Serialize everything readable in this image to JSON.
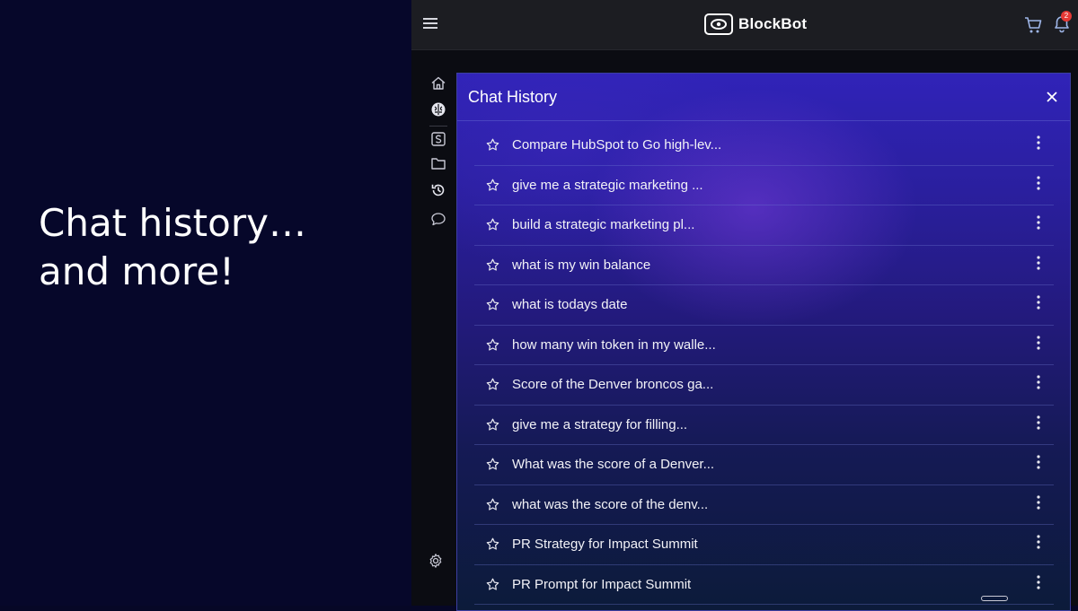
{
  "promo": {
    "line1": "Chat history…",
    "line2": "and more!"
  },
  "app": {
    "brand_name": "BlockBot",
    "notification_count": "2",
    "colors": {
      "promo_bg": "#06072a",
      "topbar_bg": "#1c1d22",
      "panel_top": "#3023b8",
      "panel_bottom": "#0c1b3a",
      "badge": "#e53935"
    }
  },
  "sidebar": {
    "icons": [
      "home-icon",
      "brain-icon",
      "s-square-icon",
      "folder-icon",
      "history-icon",
      "chat-bubble-icon",
      "settings-gear-icon"
    ]
  },
  "chat_history": {
    "title": "Chat History",
    "items": [
      {
        "label": "Compare HubSpot to Go high-lev..."
      },
      {
        "label": "give me a strategic marketing ..."
      },
      {
        "label": "build a strategic marketing pl..."
      },
      {
        "label": "what is my win balance"
      },
      {
        "label": "what is todays date"
      },
      {
        "label": "how many win token in my walle..."
      },
      {
        "label": "Score of the Denver broncos ga..."
      },
      {
        "label": "give me a strategy for filling..."
      },
      {
        "label": "What was the score of a Denver..."
      },
      {
        "label": "what was the score of the denv..."
      },
      {
        "label": "PR Strategy for Impact Summit"
      },
      {
        "label": "PR Prompt for Impact Summit"
      }
    ]
  }
}
